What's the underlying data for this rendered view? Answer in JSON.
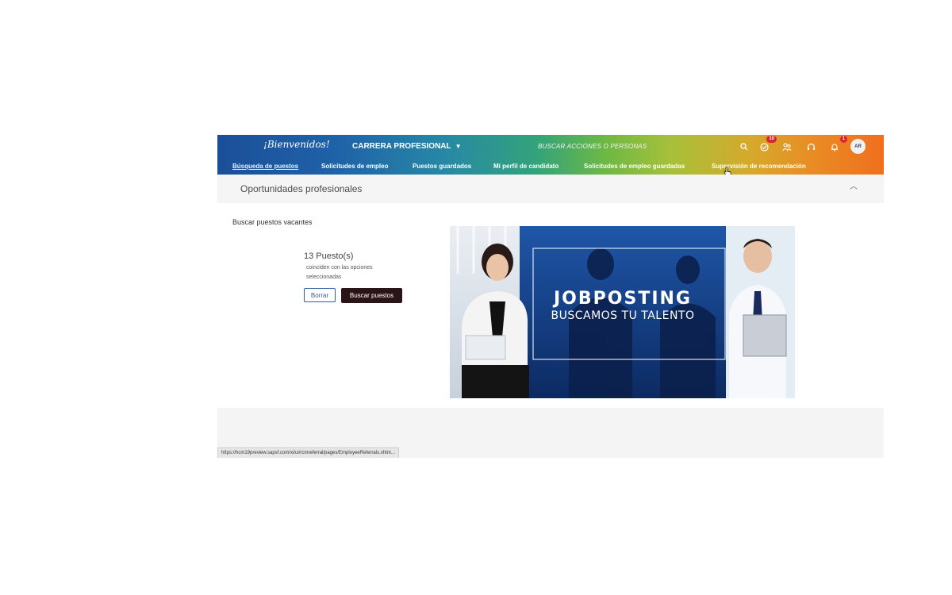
{
  "header": {
    "logo_text": "¡Bienvenidos!",
    "module_label": "CARRERA PROFESIONAL",
    "search_placeholder": "BUSCAR ACCIONES O PERSONAS",
    "icons": [
      "search-icon",
      "todo-icon",
      "people-icon",
      "help-icon",
      "bell-icon"
    ],
    "todo_badge": "10",
    "notification_badge": "1",
    "avatar_initials": "AR"
  },
  "nav": {
    "items": [
      "Búsqueda de puestos",
      "Solicitudes de empleo",
      "Puestos guardados",
      "Mi perfil de candidato",
      "Solicitudes de empleo guardadas",
      "Supervisión de recomendación"
    ],
    "active_index": 0
  },
  "page": {
    "title": "Oportunidades profesionales"
  },
  "search_panel": {
    "section_label": "Buscar puestos vacantes",
    "count": "13 Puesto(s)",
    "match_text": "coinciden con las opciones seleccionadas",
    "clear_label": "Borrar",
    "search_label": "Buscar puestos"
  },
  "banner": {
    "headline": "JOBPOSTING",
    "subline": "BUSCAMOS TU TALENTO"
  },
  "status_url": "https://hcm19preview.sapsf.com/xi/ui/rcmreferral/pages/EmployeeReferrals.xhtm..."
}
